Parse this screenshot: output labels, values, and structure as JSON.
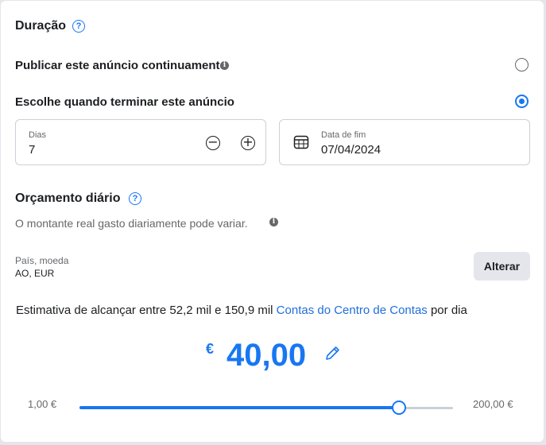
{
  "duration": {
    "title": "Duração",
    "help_icon": "question-circle-icon",
    "option_continuous": {
      "label": "Publicar este anúncio continuamente",
      "selected": false
    },
    "option_end": {
      "label": "Escolhe quando terminar este anúncio",
      "selected": true
    },
    "days": {
      "label": "Dias",
      "value": "7"
    },
    "end_date": {
      "label": "Data de fim",
      "value": "07/04/2024",
      "icon": "calendar-icon"
    }
  },
  "budget": {
    "title": "Orçamento diário",
    "note": "O montante real gasto diariamente pode variar.",
    "country_label": "País, moeda",
    "country_value": "AO, EUR",
    "change_button": "Alterar",
    "reach_prefix": "Estimativa de alcançar entre 52,2 mil e 150,9 mil",
    "reach_link": "Contas do Centro de Contas",
    "reach_suffix": "por dia",
    "currency_symbol": "€",
    "amount": "40,00",
    "edit_icon": "pencil-icon",
    "slider": {
      "min_label": "1,00 €",
      "max_label": "200,00 €",
      "value_fraction": 0.856
    }
  },
  "colors": {
    "accent": "#1877f2",
    "link": "#216fdb",
    "text": "#1c1e21",
    "muted": "#65676b"
  }
}
